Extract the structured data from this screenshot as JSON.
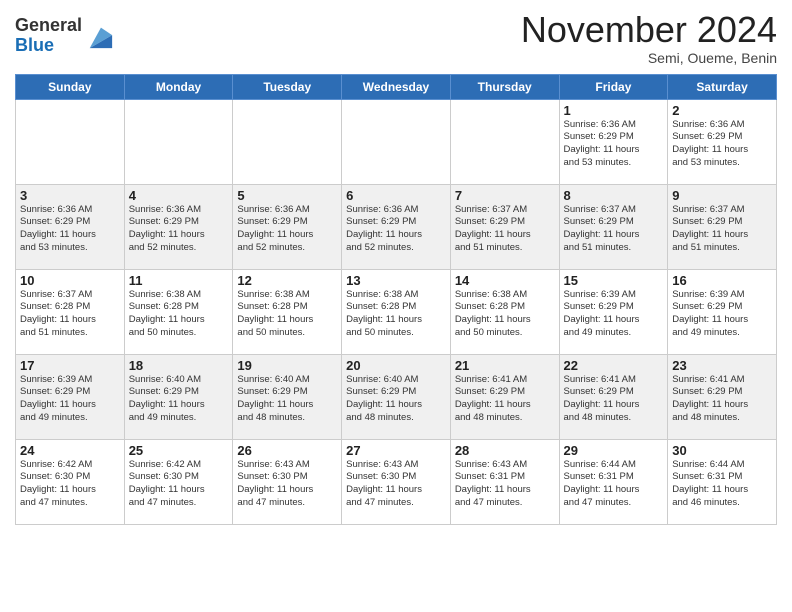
{
  "header": {
    "logo_general": "General",
    "logo_blue": "Blue",
    "month_title": "November 2024",
    "subtitle": "Semi, Oueme, Benin"
  },
  "days_of_week": [
    "Sunday",
    "Monday",
    "Tuesday",
    "Wednesday",
    "Thursday",
    "Friday",
    "Saturday"
  ],
  "weeks": [
    [
      {
        "day": "",
        "info": ""
      },
      {
        "day": "",
        "info": ""
      },
      {
        "day": "",
        "info": ""
      },
      {
        "day": "",
        "info": ""
      },
      {
        "day": "",
        "info": ""
      },
      {
        "day": "1",
        "info": "Sunrise: 6:36 AM\nSunset: 6:29 PM\nDaylight: 11 hours\nand 53 minutes."
      },
      {
        "day": "2",
        "info": "Sunrise: 6:36 AM\nSunset: 6:29 PM\nDaylight: 11 hours\nand 53 minutes."
      }
    ],
    [
      {
        "day": "3",
        "info": "Sunrise: 6:36 AM\nSunset: 6:29 PM\nDaylight: 11 hours\nand 53 minutes."
      },
      {
        "day": "4",
        "info": "Sunrise: 6:36 AM\nSunset: 6:29 PM\nDaylight: 11 hours\nand 52 minutes."
      },
      {
        "day": "5",
        "info": "Sunrise: 6:36 AM\nSunset: 6:29 PM\nDaylight: 11 hours\nand 52 minutes."
      },
      {
        "day": "6",
        "info": "Sunrise: 6:36 AM\nSunset: 6:29 PM\nDaylight: 11 hours\nand 52 minutes."
      },
      {
        "day": "7",
        "info": "Sunrise: 6:37 AM\nSunset: 6:29 PM\nDaylight: 11 hours\nand 51 minutes."
      },
      {
        "day": "8",
        "info": "Sunrise: 6:37 AM\nSunset: 6:29 PM\nDaylight: 11 hours\nand 51 minutes."
      },
      {
        "day": "9",
        "info": "Sunrise: 6:37 AM\nSunset: 6:29 PM\nDaylight: 11 hours\nand 51 minutes."
      }
    ],
    [
      {
        "day": "10",
        "info": "Sunrise: 6:37 AM\nSunset: 6:28 PM\nDaylight: 11 hours\nand 51 minutes."
      },
      {
        "day": "11",
        "info": "Sunrise: 6:38 AM\nSunset: 6:28 PM\nDaylight: 11 hours\nand 50 minutes."
      },
      {
        "day": "12",
        "info": "Sunrise: 6:38 AM\nSunset: 6:28 PM\nDaylight: 11 hours\nand 50 minutes."
      },
      {
        "day": "13",
        "info": "Sunrise: 6:38 AM\nSunset: 6:28 PM\nDaylight: 11 hours\nand 50 minutes."
      },
      {
        "day": "14",
        "info": "Sunrise: 6:38 AM\nSunset: 6:28 PM\nDaylight: 11 hours\nand 50 minutes."
      },
      {
        "day": "15",
        "info": "Sunrise: 6:39 AM\nSunset: 6:29 PM\nDaylight: 11 hours\nand 49 minutes."
      },
      {
        "day": "16",
        "info": "Sunrise: 6:39 AM\nSunset: 6:29 PM\nDaylight: 11 hours\nand 49 minutes."
      }
    ],
    [
      {
        "day": "17",
        "info": "Sunrise: 6:39 AM\nSunset: 6:29 PM\nDaylight: 11 hours\nand 49 minutes."
      },
      {
        "day": "18",
        "info": "Sunrise: 6:40 AM\nSunset: 6:29 PM\nDaylight: 11 hours\nand 49 minutes."
      },
      {
        "day": "19",
        "info": "Sunrise: 6:40 AM\nSunset: 6:29 PM\nDaylight: 11 hours\nand 48 minutes."
      },
      {
        "day": "20",
        "info": "Sunrise: 6:40 AM\nSunset: 6:29 PM\nDaylight: 11 hours\nand 48 minutes."
      },
      {
        "day": "21",
        "info": "Sunrise: 6:41 AM\nSunset: 6:29 PM\nDaylight: 11 hours\nand 48 minutes."
      },
      {
        "day": "22",
        "info": "Sunrise: 6:41 AM\nSunset: 6:29 PM\nDaylight: 11 hours\nand 48 minutes."
      },
      {
        "day": "23",
        "info": "Sunrise: 6:41 AM\nSunset: 6:29 PM\nDaylight: 11 hours\nand 48 minutes."
      }
    ],
    [
      {
        "day": "24",
        "info": "Sunrise: 6:42 AM\nSunset: 6:30 PM\nDaylight: 11 hours\nand 47 minutes."
      },
      {
        "day": "25",
        "info": "Sunrise: 6:42 AM\nSunset: 6:30 PM\nDaylight: 11 hours\nand 47 minutes."
      },
      {
        "day": "26",
        "info": "Sunrise: 6:43 AM\nSunset: 6:30 PM\nDaylight: 11 hours\nand 47 minutes."
      },
      {
        "day": "27",
        "info": "Sunrise: 6:43 AM\nSunset: 6:30 PM\nDaylight: 11 hours\nand 47 minutes."
      },
      {
        "day": "28",
        "info": "Sunrise: 6:43 AM\nSunset: 6:31 PM\nDaylight: 11 hours\nand 47 minutes."
      },
      {
        "day": "29",
        "info": "Sunrise: 6:44 AM\nSunset: 6:31 PM\nDaylight: 11 hours\nand 47 minutes."
      },
      {
        "day": "30",
        "info": "Sunrise: 6:44 AM\nSunset: 6:31 PM\nDaylight: 11 hours\nand 46 minutes."
      }
    ]
  ]
}
